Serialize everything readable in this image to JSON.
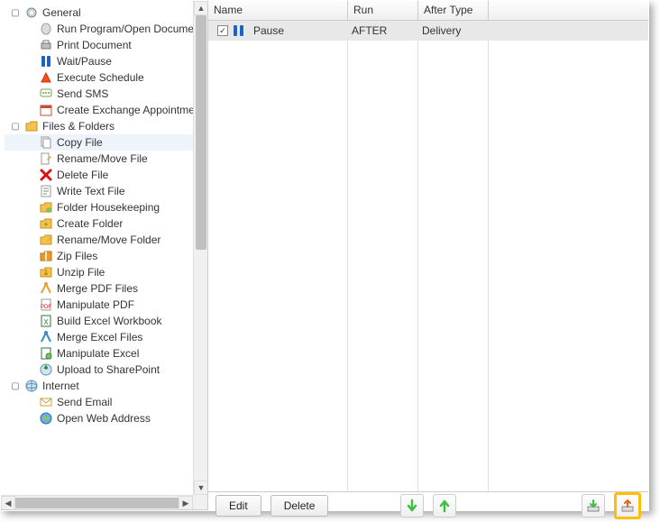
{
  "tree": {
    "groups": [
      {
        "id": "general",
        "label": "General",
        "expanded": true,
        "icon": "gear-icon",
        "items": [
          {
            "label": "Run Program/Open Document",
            "icon": "run-program-icon"
          },
          {
            "label": "Print Document",
            "icon": "printer-icon"
          },
          {
            "label": "Wait/Pause",
            "icon": "pause-icon"
          },
          {
            "label": "Execute Schedule",
            "icon": "execute-icon"
          },
          {
            "label": "Send SMS",
            "icon": "sms-icon"
          },
          {
            "label": "Create Exchange Appointment",
            "icon": "calendar-icon"
          }
        ]
      },
      {
        "id": "files",
        "label": "Files & Folders",
        "expanded": true,
        "icon": "folder-icon",
        "items": [
          {
            "label": "Copy File",
            "icon": "copy-file-icon",
            "selected": true
          },
          {
            "label": "Rename/Move File",
            "icon": "rename-file-icon"
          },
          {
            "label": "Delete File",
            "icon": "delete-icon"
          },
          {
            "label": "Write Text File",
            "icon": "text-file-icon"
          },
          {
            "label": "Folder Housekeeping",
            "icon": "housekeeping-icon"
          },
          {
            "label": "Create Folder",
            "icon": "create-folder-icon"
          },
          {
            "label": "Rename/Move Folder",
            "icon": "rename-folder-icon"
          },
          {
            "label": "Zip Files",
            "icon": "zip-icon"
          },
          {
            "label": "Unzip File",
            "icon": "unzip-icon"
          },
          {
            "label": "Merge PDF Files",
            "icon": "merge-pdf-icon"
          },
          {
            "label": "Manipulate PDF",
            "icon": "pdf-icon"
          },
          {
            "label": "Build Excel Workbook",
            "icon": "excel-icon"
          },
          {
            "label": "Merge Excel Files",
            "icon": "merge-excel-icon"
          },
          {
            "label": "Manipulate Excel",
            "icon": "manipulate-excel-icon"
          },
          {
            "label": "Upload to SharePoint",
            "icon": "sharepoint-icon"
          }
        ]
      },
      {
        "id": "internet",
        "label": "Internet",
        "expanded": true,
        "icon": "globe-icon",
        "items": [
          {
            "label": "Send Email",
            "icon": "email-icon"
          },
          {
            "label": "Open Web Address",
            "icon": "web-icon"
          }
        ]
      }
    ]
  },
  "table": {
    "columns": {
      "name": "Name",
      "run": "Run",
      "after": "After Type"
    },
    "rows": [
      {
        "checked": true,
        "icon": "pause-icon",
        "name": "Pause",
        "run": "AFTER",
        "after": "Delivery"
      }
    ]
  },
  "buttons": {
    "edit": "Edit",
    "delete": "Delete"
  }
}
